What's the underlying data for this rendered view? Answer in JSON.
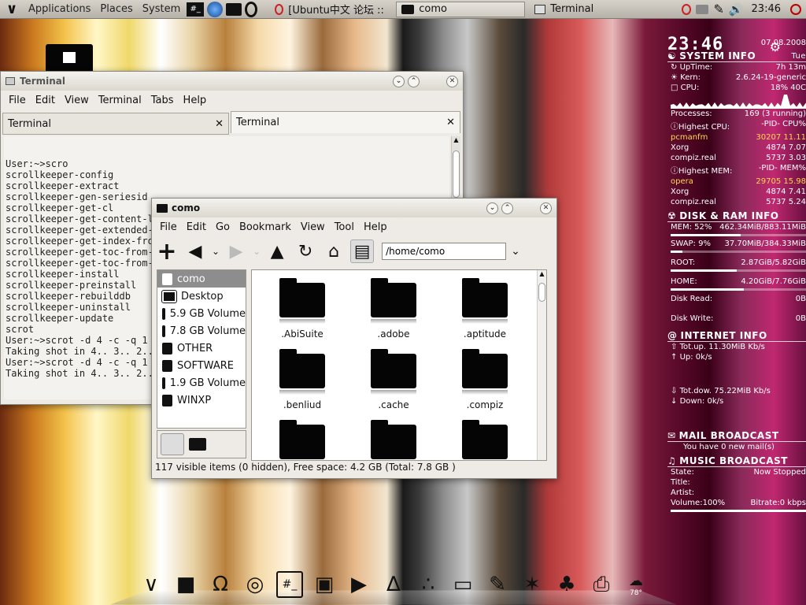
{
  "top_panel": {
    "menus": [
      "Applications",
      "Places",
      "System"
    ],
    "launchers": [
      "terminal-icon",
      "globe-icon",
      "folder-icon",
      "opera-icon"
    ],
    "tasks": [
      {
        "label": "[Ubuntu中文 论坛 :: ...",
        "icon": "opera-icon"
      },
      {
        "label": "como",
        "icon": "folder-icon"
      },
      {
        "label": "Terminal",
        "icon": "terminal-icon"
      }
    ],
    "clock": "23:46"
  },
  "desktop": {
    "home_icon": "home-folder-icon"
  },
  "terminal": {
    "title": "Terminal",
    "menus": [
      "File",
      "Edit",
      "View",
      "Terminal",
      "Tabs",
      "Help"
    ],
    "tabs": [
      "Terminal",
      "Terminal"
    ],
    "lines": [
      "User:~>scro",
      "scrollkeeper-config",
      "scrollkeeper-extract",
      "scrollkeeper-gen-seriesid",
      "scrollkeeper-get-cl",
      "scrollkeeper-get-content-list",
      "scrollkeeper-get-extended-c",
      "scrollkeeper-get-index-from",
      "scrollkeeper-get-toc-from-c",
      "scrollkeeper-get-toc-from-i",
      "scrollkeeper-install",
      "scrollkeeper-preinstall",
      "scrollkeeper-rebuilddb",
      "scrollkeeper-uninstall",
      "scrollkeeper-update",
      "scrot",
      "User:~>scrot -d 4 -c -q 1",
      "Taking shot in 4.. 3.. 2..",
      "User:~>scrot -d 4 -c -q 1",
      "Taking shot in 4.. 3.. 2.."
    ]
  },
  "filemanager": {
    "title": "como",
    "menus": [
      "File",
      "Edit",
      "Go",
      "Bookmark",
      "View",
      "Tool",
      "Help"
    ],
    "path": "/home/como",
    "sidebar": [
      "como",
      "Desktop",
      "5.9 GB Volume",
      "7.8 GB Volume",
      "OTHER",
      "SOFTWARE",
      "1.9 GB Volume",
      "WINXP"
    ],
    "files": [
      ".AbiSuite",
      ".adobe",
      ".aptitude",
      ".benliud",
      ".cache",
      ".compiz",
      "",
      "",
      ""
    ],
    "status": "117 visible items (0 hidden), Free space: 4.2 GB (Total: 7.8 GB )"
  },
  "conky": {
    "time": "23:46",
    "date": "07.08.2008",
    "day": "Tue",
    "sys_header": "SYSTEM INFO",
    "uptime_label": "UpTime:",
    "uptime": "7h 13m",
    "kern_label": "Kern:",
    "kern": "2.6.24-19-generic",
    "cpu_label": "CPU:",
    "cpu": "18% 40C",
    "proc_label": "Processes:",
    "proc": "169  (3 running)",
    "topcpu_header": "Highest CPU:",
    "pid_col": "-PID-",
    "cpu_col": "CPU%",
    "topcpu": [
      [
        "pcmanfm",
        "30207 11.11"
      ],
      [
        "Xorg",
        "4874  7.07"
      ],
      [
        "compiz.real",
        "5737  3.03"
      ]
    ],
    "topmem_header": "Highest MEM:",
    "mem_col": "MEM%",
    "topmem": [
      [
        "opera",
        "29705 15.98"
      ],
      [
        "Xorg",
        "4874  7.41"
      ],
      [
        "compiz.real",
        "5737  5.24"
      ]
    ],
    "disk_header": "DISK & RAM INFO",
    "mem_label": "MEM: 52%",
    "mem": "462.34MiB/883.11MiB",
    "mem_pct": 52,
    "swap_label": "SWAP: 9%",
    "swap": "37.70MiB/384.33MiB",
    "swap_pct": 9,
    "root_label": "ROOT:",
    "root": "2.87GiB/5.82GiB",
    "root_pct": 49,
    "home_label": "HOME:",
    "home": "4.20GiB/7.76GiB",
    "home_pct": 54,
    "dread_label": "Disk Read:",
    "dread": "0B",
    "dwrite_label": "Disk Write:",
    "dwrite": "0B",
    "net_header": "INTERNET INFO",
    "totup": "Tot.up. 11.30MiB Kb/s",
    "up": "Up: 0k/s",
    "totdown": "Tot.dow. 75.22MiB Kb/s",
    "down": "Down: 0k/s",
    "mail_header": "MAIL BROADCAST",
    "mail": "You have 0 new mail(s)",
    "music_header": "MUSIC BROADCAST",
    "state_label": "State:",
    "state": "Now Stopped",
    "title_label": "Title:",
    "artist_label": "Artist:",
    "volume_label": "Volume:",
    "volume": "100%",
    "bitrate_label": "Bitrate:",
    "bitrate": "0 kbps"
  },
  "dock": {
    "items": [
      "menu-icon",
      "folder-icon",
      "omega-icon",
      "globe-icon",
      "terminal-icon",
      "mb-icon",
      "player-icon",
      "inkscape-icon",
      "acrobat-icon",
      "drive-icon",
      "pencil-icon",
      "gimp-icon",
      "dog-icon",
      "printer-icon",
      "weather-icon"
    ],
    "weather_temp": "78°"
  },
  "colors": {
    "conky_yellow": "#ffd84a",
    "selection": "#8d8d8d"
  }
}
